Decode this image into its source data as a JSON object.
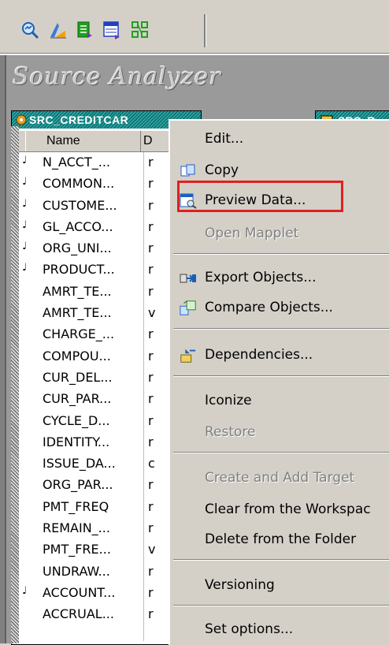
{
  "toolbar": {
    "icons": [
      "source-analyzer-icon",
      "target-designer-icon",
      "transformation-developer-icon",
      "mapplet-designer-icon",
      "mapping-designer-icon"
    ]
  },
  "workspace": {
    "title": "Source Analyzer"
  },
  "source_window": {
    "title": "SRC_CREDITCAR",
    "columns": [
      "Name",
      "D"
    ],
    "rows": [
      {
        "key": true,
        "name": "N_ACCT_...",
        "type": "r"
      },
      {
        "key": true,
        "name": "COMMON...",
        "type": "r"
      },
      {
        "key": true,
        "name": "CUSTOME...",
        "type": "r"
      },
      {
        "key": true,
        "name": "GL_ACCO...",
        "type": "r"
      },
      {
        "key": true,
        "name": "ORG_UNI...",
        "type": "r"
      },
      {
        "key": true,
        "name": "PRODUCT...",
        "type": "r"
      },
      {
        "key": false,
        "name": "AMRT_TE...",
        "type": "r"
      },
      {
        "key": false,
        "name": "AMRT_TE...",
        "type": "v"
      },
      {
        "key": false,
        "name": "CHARGE_...",
        "type": "r"
      },
      {
        "key": false,
        "name": "COMPOU...",
        "type": "r"
      },
      {
        "key": false,
        "name": "CUR_DEL...",
        "type": "r"
      },
      {
        "key": false,
        "name": "CUR_PAR...",
        "type": "r"
      },
      {
        "key": false,
        "name": "CYCLE_D...",
        "type": "r"
      },
      {
        "key": false,
        "name": "IDENTITY...",
        "type": "r"
      },
      {
        "key": false,
        "name": "ISSUE_DA...",
        "type": "c"
      },
      {
        "key": false,
        "name": "ORG_PAR...",
        "type": "r"
      },
      {
        "key": false,
        "name": "PMT_FREQ",
        "type": "r"
      },
      {
        "key": false,
        "name": "REMAIN_...",
        "type": "r"
      },
      {
        "key": false,
        "name": "PMT_FRE...",
        "type": "v"
      },
      {
        "key": false,
        "name": "UNDRAW...",
        "type": "r"
      },
      {
        "key": true,
        "name": "ACCOUNT...",
        "type": "r"
      },
      {
        "key": false,
        "name": "ACCRUAL...",
        "type": "r"
      }
    ]
  },
  "target_window": {
    "title": "SRC_R"
  },
  "context_menu": {
    "items": {
      "edit": "Edit...",
      "copy": "Copy",
      "preview_data": "Preview Data...",
      "open_mapplet": "Open Mapplet",
      "export_objects": "Export Objects...",
      "compare_objects": "Compare Objects...",
      "dependencies": "Dependencies...",
      "iconize": "Iconize",
      "restore": "Restore",
      "create_and_add_target": "Create and Add Target",
      "clear_from_workspace": "Clear from the Workspac",
      "delete_from_folder": "Delete from the Folder",
      "versioning": "Versioning",
      "set_options": "Set options..."
    }
  },
  "colors": {
    "highlight": "#e02020",
    "title_bar": "#007b7b",
    "menu_bg": "#d4d0c8"
  }
}
